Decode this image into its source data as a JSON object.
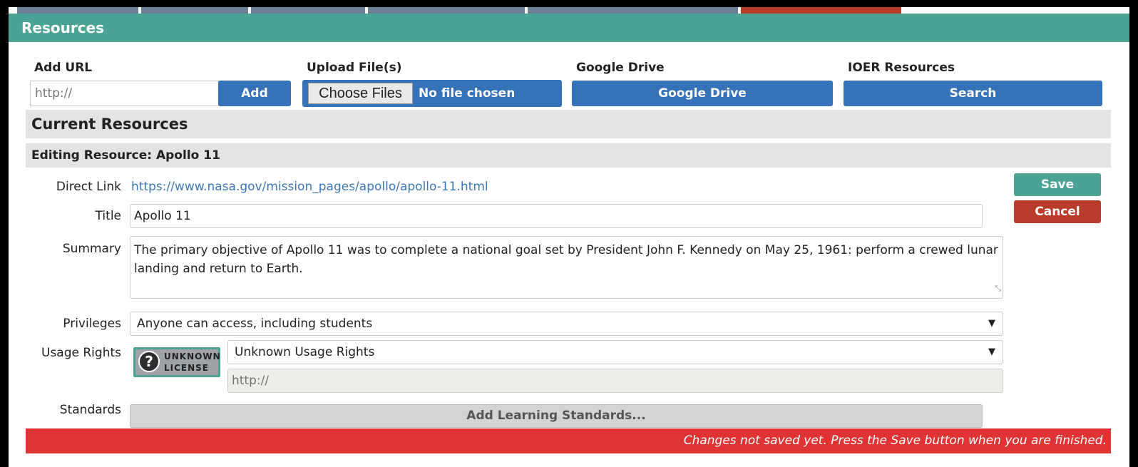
{
  "panel": {
    "title": "Resources"
  },
  "upload": {
    "add_url": {
      "label": "Add URL",
      "placeholder": "http://",
      "button": "Add"
    },
    "upload_file": {
      "label": "Upload File(s)",
      "choose_button": "Choose Files",
      "status": "No file chosen"
    },
    "google_drive": {
      "label": "Google Drive",
      "button": "Google Drive"
    },
    "ioer": {
      "label": "IOER Resources",
      "button": "Search"
    }
  },
  "current": {
    "title": "Current Resources"
  },
  "editing": {
    "title": "Editing Resource: Apollo 11",
    "direct_link_label": "Direct Link",
    "direct_link": "https://www.nasa.gov/mission_pages/apollo/apollo-11.html",
    "title_label": "Title",
    "title_value": "Apollo 11",
    "summary_label": "Summary",
    "summary_value": "The primary objective of Apollo 11 was to complete a national goal set by President John F. Kennedy on May 25, 1961: perform a crewed lunar landing and return to Earth.",
    "privileges_label": "Privileges",
    "privileges_value": "Anyone can access, including students",
    "usage_label": "Usage Rights",
    "usage_value": "Unknown Usage Rights",
    "usage_url_placeholder": "http://",
    "license_badge": {
      "line1": "UNKNOWN",
      "line2": "LICENSE",
      "glyph": "?"
    },
    "standards_label": "Standards",
    "standards_button": "Add Learning Standards...",
    "save": "Save",
    "cancel": "Cancel"
  },
  "warning": "Changes not saved yet. Press the Save button when you are finished.",
  "colors": {
    "header_teal": "#4aa394",
    "button_blue": "#3572b7",
    "cancel_red": "#b83c2a",
    "warning_red": "#e03333",
    "link_blue": "#3c78b7"
  }
}
